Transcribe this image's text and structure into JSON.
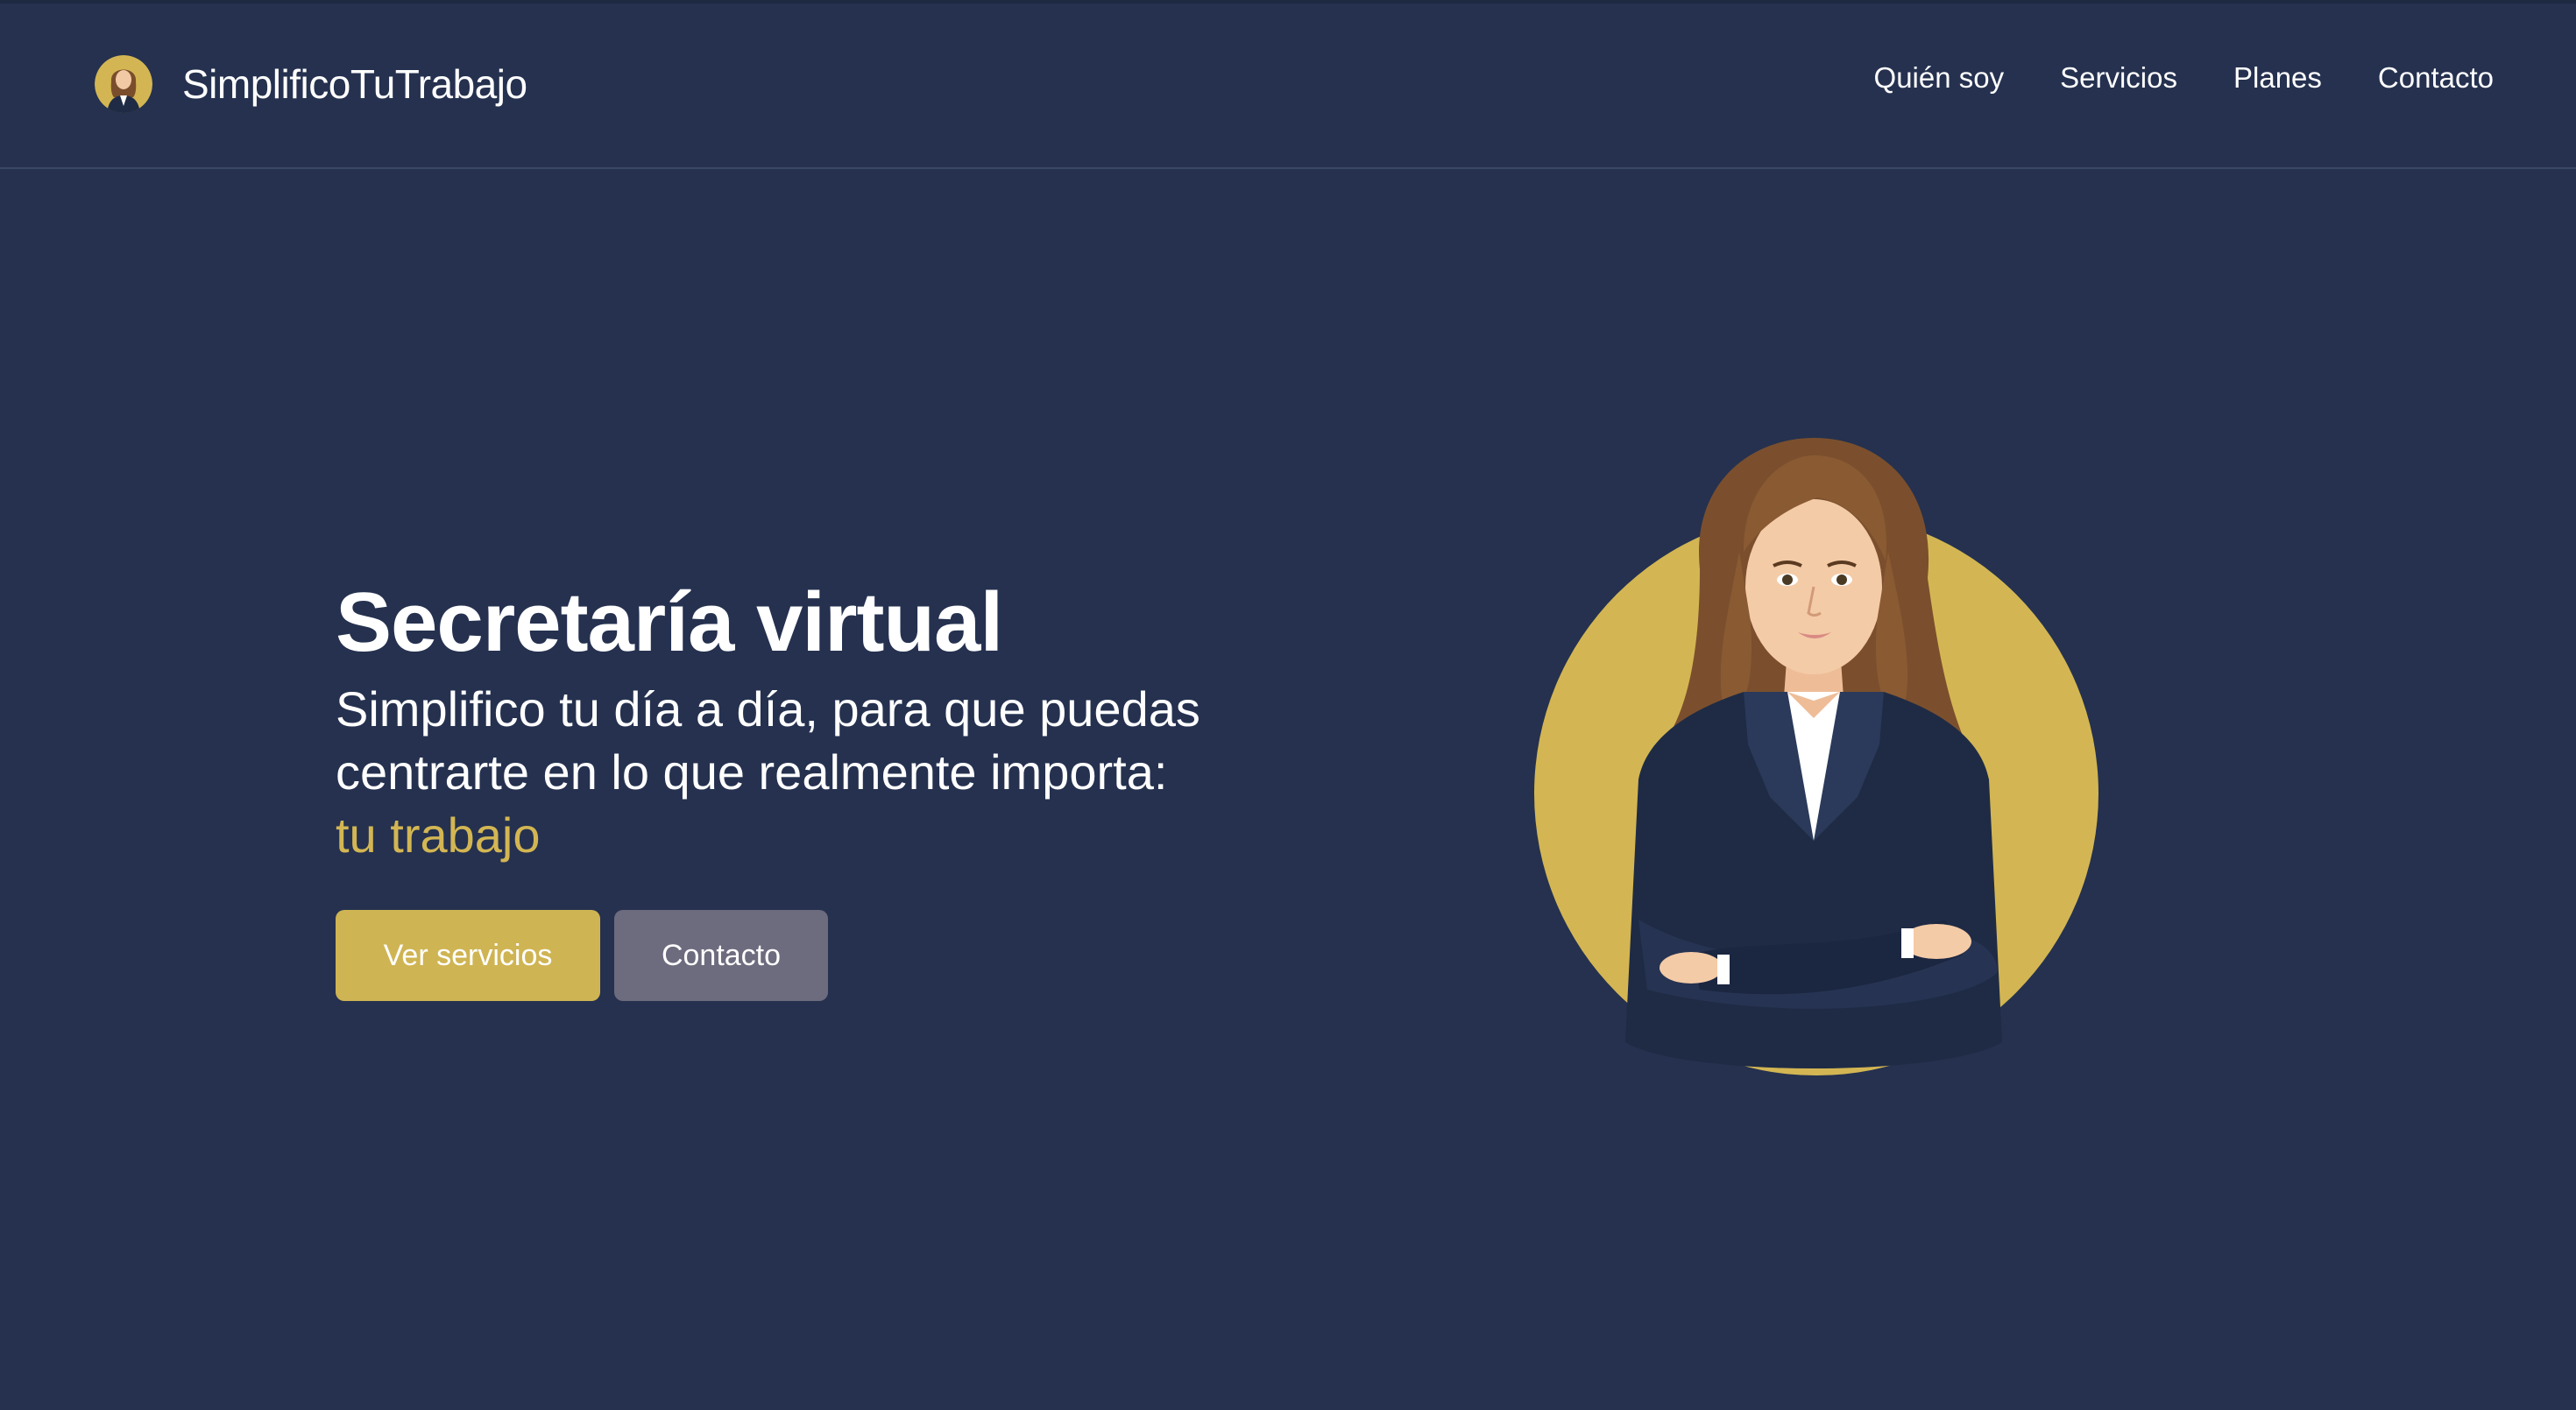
{
  "header": {
    "brand_name": "SimplificoTuTrabajo",
    "nav": [
      "Quién soy",
      "Servicios",
      "Planes",
      "Contacto"
    ]
  },
  "hero": {
    "title": "Secretaría virtual",
    "subtitle_line1": "Simplifico tu día a día, para que puedas",
    "subtitle_line2": "centrarte en lo que realmente importa:",
    "subtitle_accent": "tu trabajo",
    "primary_button": "Ver servicios",
    "secondary_button": "Contacto"
  },
  "colors": {
    "background": "#25314f",
    "accent": "#d3b653",
    "primary_button": "#cfb453",
    "secondary_button": "#6d6b7e"
  },
  "icons": {
    "brand_logo": "woman-avatar-icon",
    "hero_image": "woman-in-suit-illustration"
  }
}
